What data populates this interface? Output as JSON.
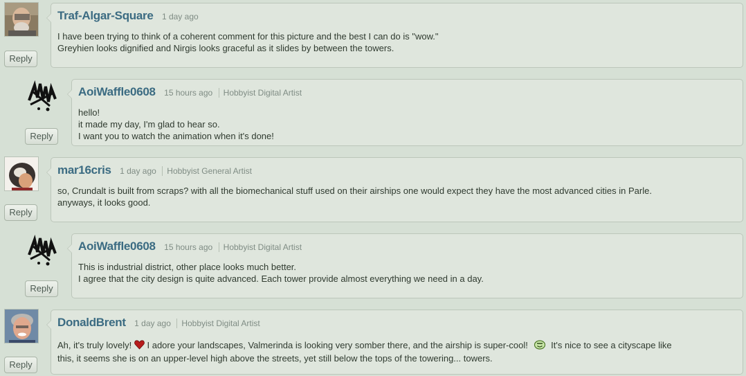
{
  "reply_label": "Reply",
  "comments": [
    {
      "username": "Traf-Algar-Square",
      "time": "1 day ago",
      "role": "",
      "lines": [
        "I have been trying to think of a coherent comment for this picture and the best I can do is \"wow.\"",
        "Greyhien looks dignified and Nirgis looks graceful as it slides by between the towers."
      ]
    },
    {
      "username": "AoiWaffle0608",
      "time": "15 hours ago",
      "role": "Hobbyist Digital Artist",
      "lines": [
        "hello!",
        "it made my day, I'm glad to hear so.",
        "I want you to watch the animation when it's done!"
      ]
    },
    {
      "username": "mar16cris",
      "time": "1 day ago",
      "role": "Hobbyist General Artist",
      "lines": [
        "so, Crundalt is built from scraps? with all the biomechanical stuff used on their airships one would expect they have the most advanced cities in Parle.",
        "anyways, it looks good."
      ]
    },
    {
      "username": "AoiWaffle0608",
      "time": "15 hours ago",
      "role": "Hobbyist Digital Artist",
      "lines": [
        "This is industrial district, other place looks much better.",
        "I agree that the city design is quite advanced. Each tower provide almost everything we need in a day."
      ]
    },
    {
      "username": "DonaldBrent",
      "time": "1 day ago",
      "role": "Hobbyist Digital Artist",
      "line1_a": "Ah, it's truly lovely!",
      "line1_b": "I adore your landscapes, Valmerinda is looking very somber there, and the airship is super-cool!",
      "line1_c": "It's nice to see a cityscape like",
      "line2": "this, it seems she is on an upper-level high above the streets, yet still below the tops of the towering... towers."
    }
  ],
  "icons": {
    "heart": "heart-emoticon-icon",
    "smile": "smiley-emoticon-icon"
  }
}
